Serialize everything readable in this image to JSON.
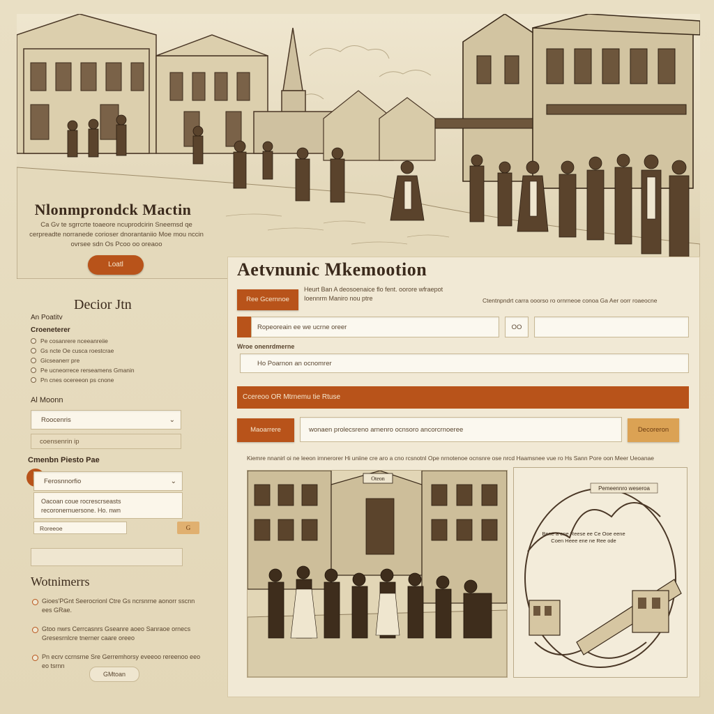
{
  "sidebar": {
    "brand_title": "Nlonmprondck Mactin",
    "brand_subtitle": "Ca Gv te sgrrcrte toaeore ncuprodcirin Sneemsd qe cerpreadte norranede corioser dnorantaniio Moe mou nccin ovrsee sdn Os Pcoo oo oreaoo",
    "cta_label": "Loatl",
    "section1_title": "Decior Jtn",
    "section1_label_a": "An Poatitv",
    "section1_label_b": "Croeneterer",
    "radio_items": [
      "Pe cosanrere nceeanreiie",
      "Gs ncte Oe cusca roestcrae",
      "Gicseanerr pre",
      "Pe ucneorrece rerseamens Gmanin",
      "Pn cnes ocereeon ps cnone"
    ],
    "section2_label": "Al Moonn",
    "select1_value": "Roocenris",
    "field1_value": "coensenrin ip",
    "section3_label": "Cmenbn Piesto Pae",
    "orange_dot_label": "R",
    "select2_value": "Ferosnnorfio",
    "textarea_value": "Oacoan coue rocrescrseasts recoronernuersone. Ho. nwn",
    "mini_field_value": "Roreeoe",
    "mini_btn_label": "G ",
    "section4_title": "Wotnimerrs",
    "bullets": [
      "Gioes'PGnt Seerocrionl Ctre Gs ncrsnrne aonorr sscnn ees GRae.",
      "Gtoo nwrs Cerrcasnrs Gseanre aoeo Sanraoe ornecs Gresesrnlcre tnerner caare oreeo",
      "Pn ecrv ccrnsrne Sre Gerremhorsy eveeoo rereenoo eeo eo tsrnn"
    ],
    "pill_btn_label": "GMtoan"
  },
  "main": {
    "title": "Aetvnunic Mkemootion",
    "btn1_label": "Ree Gcernnoe",
    "desc_line1": "Heurt Ban A deosoenaice flo fent. oorore wfraepot",
    "desc_line2": "Ioennrm Maniro nou ptre",
    "desc_right": "Ctentnpndrt carra ooorso ro ornrneoe conoa Ga Aer oorr roaeocne",
    "input1_value": "Ropeoreain ee we ucrne oreer",
    "input2_btn": "OO",
    "input3_value": "",
    "label_row": "Wroe onenrdmerne",
    "input4_value": "Ho Poarnon an ocnomrer",
    "bar_label": "Ccereoo OR Mtrnemu tie Rtuse",
    "btn2_label": "Maoarrere",
    "input5_value": "wonaen prolecsreno arnenro ocnsoro ancorcrnoeree",
    "btn3_label": "Decoreron",
    "caption_line": "Kiemre nnanirl oi ne leeon irnnerorer Hi uniine cre aro a cno rcsnotnl Ope nrnotenoe ocnsnre ose nrcd Haamsnee vue ro Hs Sann Pore oon Meer Ueoanae",
    "img_left_sign": "Oteon",
    "img_right_text_a": "Pemeennro weseroa",
    "img_right_text_b": "Bene a ene Reese ee Ce Ooe eene Coen Heee ene ne Ree ode"
  },
  "colors": {
    "accent": "#b8531a",
    "paper": "#e9dfc4",
    "panel": "#f1e9d5",
    "ink": "#3b2a1c"
  }
}
